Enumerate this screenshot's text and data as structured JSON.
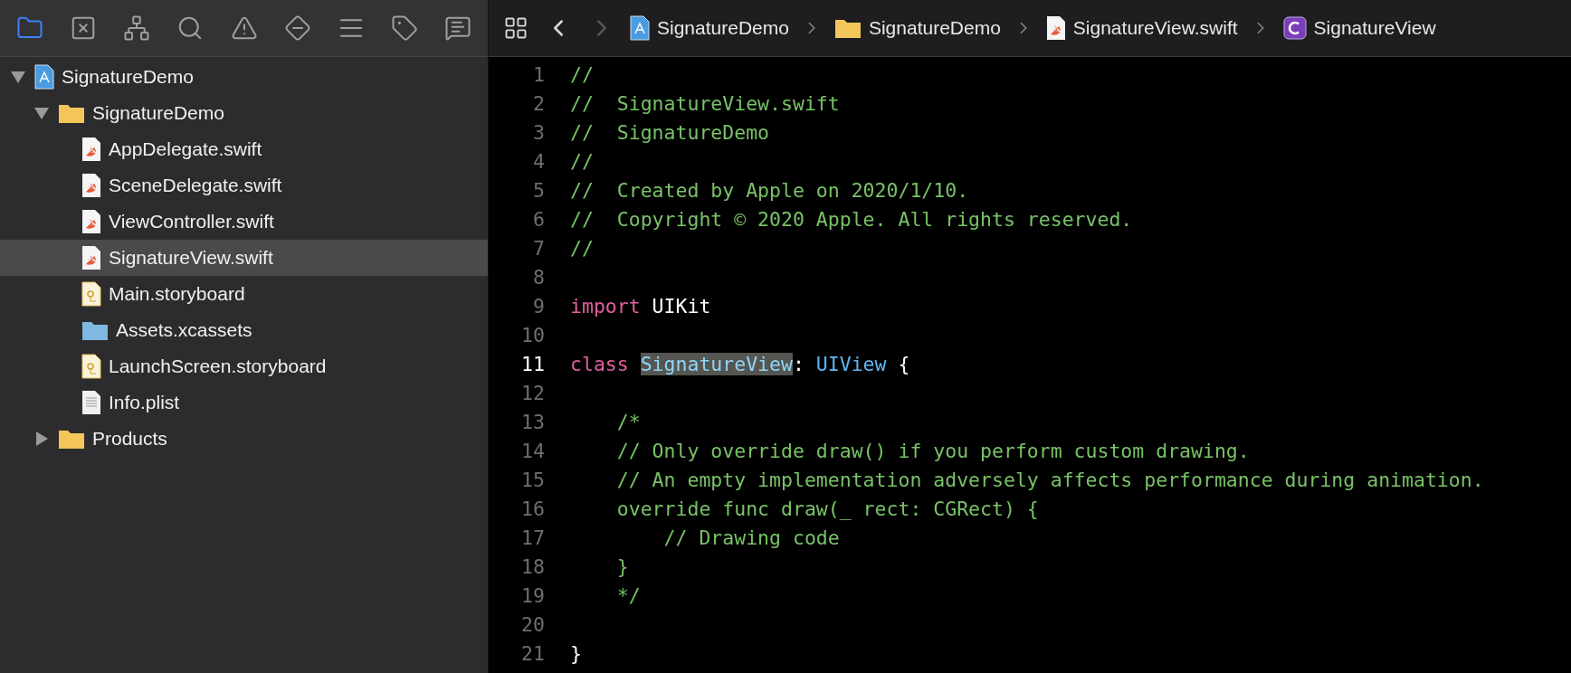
{
  "navigator_tabs": [
    {
      "kind": "project",
      "selected": true
    },
    {
      "kind": "source-control",
      "selected": false
    },
    {
      "kind": "symbols",
      "selected": false
    },
    {
      "kind": "find",
      "selected": false
    },
    {
      "kind": "issues",
      "selected": false
    },
    {
      "kind": "tests",
      "selected": false
    },
    {
      "kind": "debug",
      "selected": false
    },
    {
      "kind": "breakpoints",
      "selected": false
    },
    {
      "kind": "reports",
      "selected": false
    }
  ],
  "history_buttons": [
    {
      "kind": "back",
      "disabled": false
    },
    {
      "kind": "forward",
      "disabled": true
    }
  ],
  "breadcrumbs": [
    {
      "kind": "project",
      "label": "SignatureDemo"
    },
    {
      "kind": "folder",
      "label": "SignatureDemo"
    },
    {
      "kind": "swift",
      "label": "SignatureView.swift"
    },
    {
      "kind": "class",
      "label": "SignatureView"
    }
  ],
  "tree": [
    {
      "kind": "project",
      "label": "SignatureDemo",
      "expanded": true,
      "selected": false,
      "children": [
        {
          "kind": "folder",
          "label": "SignatureDemo",
          "expanded": true,
          "selected": false,
          "children": [
            {
              "kind": "swift",
              "label": "AppDelegate.swift",
              "selected": false
            },
            {
              "kind": "swift",
              "label": "SceneDelegate.swift",
              "selected": false
            },
            {
              "kind": "swift",
              "label": "ViewController.swift",
              "selected": false
            },
            {
              "kind": "swift",
              "label": "SignatureView.swift",
              "selected": true
            },
            {
              "kind": "storyboard",
              "label": "Main.storyboard",
              "selected": false
            },
            {
              "kind": "assets",
              "label": "Assets.xcassets",
              "selected": false
            },
            {
              "kind": "storyboard",
              "label": "LaunchScreen.storyboard",
              "selected": false
            },
            {
              "kind": "plist",
              "label": "Info.plist",
              "selected": false
            }
          ]
        },
        {
          "kind": "folder",
          "label": "Products",
          "expanded": false,
          "selected": false
        }
      ]
    }
  ],
  "code_lines": [
    {
      "number": "1",
      "current": false,
      "tokens": [
        {
          "kind": "comment",
          "text": "//"
        }
      ]
    },
    {
      "number": "2",
      "current": false,
      "tokens": [
        {
          "kind": "comment",
          "text": "//  SignatureView.swift"
        }
      ]
    },
    {
      "number": "3",
      "current": false,
      "tokens": [
        {
          "kind": "comment",
          "text": "//  SignatureDemo"
        }
      ]
    },
    {
      "number": "4",
      "current": false,
      "tokens": [
        {
          "kind": "comment",
          "text": "//"
        }
      ]
    },
    {
      "number": "5",
      "current": false,
      "tokens": [
        {
          "kind": "comment",
          "text": "//  Created by Apple on 2020/1/10."
        }
      ]
    },
    {
      "number": "6",
      "current": false,
      "tokens": [
        {
          "kind": "comment",
          "text": "//  Copyright © 2020 Apple. All rights reserved."
        }
      ]
    },
    {
      "number": "7",
      "current": false,
      "tokens": [
        {
          "kind": "comment",
          "text": "//"
        }
      ]
    },
    {
      "number": "8",
      "current": false
    },
    {
      "number": "9",
      "current": false,
      "tokens": [
        {
          "kind": "keyword",
          "text": "import"
        },
        {
          "kind": "plain",
          "text": " UIKit"
        }
      ]
    },
    {
      "number": "10",
      "current": false
    },
    {
      "number": "11",
      "current": true,
      "tokens": [
        {
          "kind": "keyword",
          "text": "class "
        },
        {
          "kind": "highlighted",
          "text": "SignatureView"
        },
        {
          "kind": "plain",
          "text": ": "
        },
        {
          "kind": "type",
          "text": "UIView"
        },
        {
          "kind": "plain",
          "text": " {"
        }
      ]
    },
    {
      "number": "12",
      "current": false
    },
    {
      "number": "13",
      "current": false,
      "tokens": [
        {
          "kind": "comment",
          "text": "    /*"
        }
      ]
    },
    {
      "number": "14",
      "current": false,
      "tokens": [
        {
          "kind": "comment",
          "text": "    // Only override draw() if you perform custom drawing."
        }
      ]
    },
    {
      "number": "15",
      "current": false,
      "tokens": [
        {
          "kind": "comment",
          "text": "    // An empty implementation adversely affects performance during animation."
        }
      ]
    },
    {
      "number": "16",
      "current": false,
      "tokens": [
        {
          "kind": "comment",
          "text": "    override func draw(_ rect: CGRect) {"
        }
      ]
    },
    {
      "number": "17",
      "current": false,
      "tokens": [
        {
          "kind": "comment",
          "text": "        // Drawing code"
        }
      ]
    },
    {
      "number": "18",
      "current": false,
      "tokens": [
        {
          "kind": "comment",
          "text": "    }"
        }
      ]
    },
    {
      "number": "19",
      "current": false,
      "tokens": [
        {
          "kind": "comment",
          "text": "    */"
        }
      ]
    },
    {
      "number": "20",
      "current": false
    },
    {
      "number": "21",
      "current": false,
      "tokens": [
        {
          "kind": "plain",
          "text": "}"
        }
      ]
    }
  ]
}
